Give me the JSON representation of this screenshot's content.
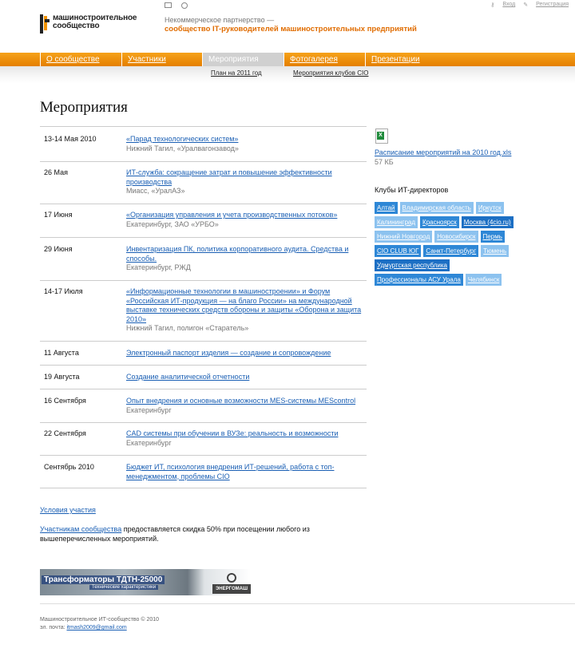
{
  "header": {
    "logo_line1": "машиностроительное",
    "logo_line2": "сообщество",
    "tagline_line1": "Некоммерческое партнерство —",
    "tagline_line2": "сообщество IT-руководителей машиностроительных предприятий",
    "login": "Вход",
    "register": "Регистрация",
    "icons": [
      "mail-icon",
      "search-icon",
      "key-icon",
      "pencil-icon"
    ]
  },
  "nav": {
    "items": [
      {
        "label": "О сообществе",
        "active": false
      },
      {
        "label": "Участники",
        "active": false
      },
      {
        "label": "Мероприятия",
        "active": true
      },
      {
        "label": "Фотогалерея",
        "active": false
      },
      {
        "label": "Презентации",
        "active": false
      }
    ],
    "sub": [
      "План на 2011 год",
      "Мероприятия клубов CIO"
    ]
  },
  "page_title": "Мероприятия",
  "events": [
    {
      "date": "13-14 Мая 2010",
      "title": "«Парад технологических систем»",
      "place": "Нижний Тагил, «Уралвагонзавод»"
    },
    {
      "date": "26 Мая",
      "title": "ИТ-служба: сокращение затрат и повышение эффективности производства",
      "place": "Миасс, «УралАЗ»"
    },
    {
      "date": "17 Июня",
      "title": "«Организация управления и учета производственных потоков»",
      "place": "Екатеринбург, ЗАО «УРБО»"
    },
    {
      "date": "29 Июня",
      "title": "Инвентаризация ПК, политика корпоративного аудита. Средства и способы.",
      "place": "Екатеринбург, РЖД"
    },
    {
      "date": "14-17 Июля",
      "title": "«Информационные технологии в машиностроении» и Форум «Российская ИТ-продукция — на благо России» на международной выставке технических средств обороны и защиты «Оборона и защита 2010»",
      "place": "Нижний Тагил, полигон «Старатель»"
    },
    {
      "date": "11 Августа",
      "title": "Электронный паспорт изделия — создание и сопровождение",
      "place": ""
    },
    {
      "date": "19 Августа",
      "title": "Создание аналитической отчетности",
      "place": ""
    },
    {
      "date": "16 Сентября",
      "title": "Опыт внедрения и основные возможности MES-системы MEScontrol",
      "place": "Екатеринбург"
    },
    {
      "date": "22 Сентября",
      "title": "CAD системы при обучении в ВУЗе: реальность и возможности",
      "place": "Екатеринбург"
    },
    {
      "date": "Сентябрь 2010",
      "title": "Бюджет ИТ, психология внедрения ИТ-решений, работа с топ-менеджментом, проблемы CIO",
      "place": ""
    }
  ],
  "conditions_link": "Условия участия",
  "note": {
    "link": "Участникам сообщества",
    "text": " предоставляется скидка 50% при посещении любого из вышеперечисленных мероприятий."
  },
  "banner": {
    "line1": "Трансформаторы ТДТН-25000",
    "line2": "Технические характеристики",
    "brand": "ЭНЕРГОМАШ"
  },
  "footer": {
    "copyright": "Машиностроительное ИТ-сообщество © 2010",
    "email_label": "эл. почта: ",
    "email": "itmash2009@gmail.com"
  },
  "sidebar": {
    "file_link": "Расписание мероприятий на 2010 год.xls",
    "file_size": "57 КБ",
    "clubs_title": "Клубы ИТ-директоров",
    "clubs": [
      {
        "label": "Алтай",
        "style": "t1"
      },
      {
        "label": "Владимирская область",
        "style": "t2"
      },
      {
        "label": "Иркутск",
        "style": "t2"
      },
      {
        "label": "Калининград",
        "style": "t2"
      },
      {
        "label": "Красноярск",
        "style": "t1"
      },
      {
        "label": "Москва (4cio.ru)",
        "style": "t3"
      },
      {
        "label": "Нижний Новгород",
        "style": "t2"
      },
      {
        "label": "Новосибирск",
        "style": "t2"
      },
      {
        "label": "Пермь",
        "style": "t1"
      },
      {
        "label": "CIO CLUB ЮГ",
        "style": "t1"
      },
      {
        "label": "Санкт-Петербург",
        "style": "t1"
      },
      {
        "label": "Тюмень",
        "style": "t2"
      },
      {
        "label": "Удмуртская республика",
        "style": "t3"
      },
      {
        "label": "Профессионалы АСУ Урала",
        "style": "t1"
      },
      {
        "label": "Челябинск",
        "style": "t2"
      }
    ]
  }
}
